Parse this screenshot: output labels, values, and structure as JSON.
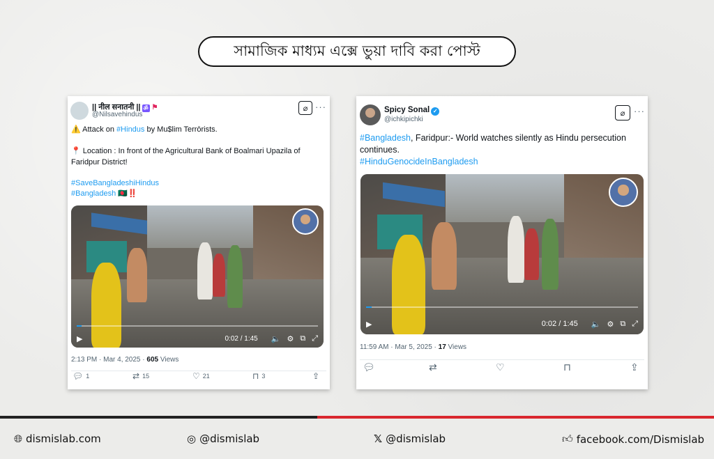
{
  "header": {
    "title": "সামাজিক মাধ্যম এক্সে ভুয়া দাবি করা পোস্ট"
  },
  "post1": {
    "user_name": "|| नील सनातनी ||",
    "user_handle": "@Nilsavehindus",
    "line1_prefix": "⚠️ Attack on ",
    "line1_hashtag": "#Hindus",
    "line1_suffix": "  by Mu$lim Terrōrists.",
    "location_text": "📍 Location : In front of the Agricultural Bank of Boalmari Upazila of Faridpur District!",
    "hashtag1": "#SaveBangladeshiHindus",
    "hashtag2": "#Bangladesh",
    "hashtag2_suffix": " 🇧🇩‼️",
    "video_time": "0:02 / 1:45",
    "video_progress": 0.02,
    "meta_time": "2:13 PM · Mar 4, 2025 · ",
    "meta_views_count": "605",
    "meta_views_label": " Views",
    "replies": "1",
    "reposts": "15",
    "likes": "21",
    "bookmarks": "3"
  },
  "post2": {
    "user_name": "Spicy Sonal",
    "user_handle": "@ichkipichki",
    "hashtag1": "#Bangladesh",
    "text1": ", Faridpur:- World watches silently as Hindu persecution continues.",
    "hashtag2": "#HinduGenocideInBangladesh",
    "video_time": "0:02 / 1:45",
    "video_progress": 0.02,
    "meta_time": "11:59 AM · Mar 5, 2025 · ",
    "meta_views_count": "17",
    "meta_views_label": " Views"
  },
  "footer": {
    "website": "dismislab.com",
    "instagram": "@dismislab",
    "x": "@dismislab",
    "facebook": "facebook.com/Dismislab"
  },
  "colors": {
    "link": "#1d9bf0",
    "accent_red": "#d9272e",
    "dark": "#222222"
  },
  "icons": [
    "globe-icon",
    "instagram-icon",
    "x-logo-icon",
    "thumbs-up-icon",
    "grok-icon",
    "more-icon",
    "play-icon",
    "volume-icon",
    "settings-icon",
    "pip-icon",
    "fullscreen-icon",
    "reply-icon",
    "repost-icon",
    "like-icon",
    "bookmark-icon",
    "share-icon",
    "verified-badge-icon"
  ]
}
